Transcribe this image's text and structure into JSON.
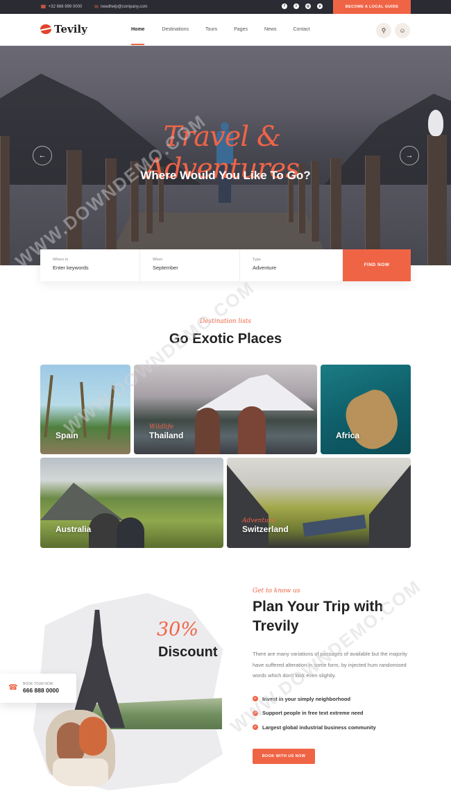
{
  "topbar": {
    "phone": "+32 666 999 0000",
    "email": "needhelp@company.com",
    "social_icons": [
      "facebook-icon",
      "twitter-icon",
      "instagram-icon",
      "pinterest-icon"
    ],
    "cta": "Become a local guide"
  },
  "nav": {
    "logo": "Tevily",
    "items": [
      "Home",
      "Destinations",
      "Tours",
      "Pages",
      "News",
      "Contact"
    ],
    "active": "Home"
  },
  "hero": {
    "script_title": "Travel & Adventures",
    "subtitle": "Where Would You Like To Go?",
    "prev_arrow": "←",
    "next_arrow": "→"
  },
  "search": {
    "fields": [
      {
        "label": "Where to",
        "value": "Enter keywords"
      },
      {
        "label": "When",
        "value": "September"
      },
      {
        "label": "Type",
        "value": "Adventure"
      }
    ],
    "button": "Find Now"
  },
  "destinations": {
    "eyebrow": "Destination lists",
    "title": "Go Exotic Places",
    "tiles": [
      {
        "name": "Spain",
        "tag": ""
      },
      {
        "name": "Thailand",
        "tag": "Wildlife"
      },
      {
        "name": "Africa",
        "tag": ""
      },
      {
        "name": "Australia",
        "tag": ""
      },
      {
        "name": "Switzerland",
        "tag": "Adventure"
      }
    ]
  },
  "plan": {
    "discount_pct": "30%",
    "discount_label": "Discount",
    "book_tour_label": "Book Tour Now",
    "book_tour_phone": "666 888 0000",
    "eyebrow": "Get to know us",
    "title": "Plan Your Trip with Trevily",
    "paragraph": "There are many variations of passages of available but the majority have suffered alteration in some form, by injected hum randomised words which don't look even slightly.",
    "bullets": [
      "Invest in your simply neighborhood",
      "Support people in free text extreme need",
      "Largest global industrial business community"
    ],
    "button": "Book with us now"
  },
  "watermark": "WWW.DOWNDEMO.COM",
  "colors": {
    "accent": "#f06446",
    "dark": "#2a2b33"
  }
}
